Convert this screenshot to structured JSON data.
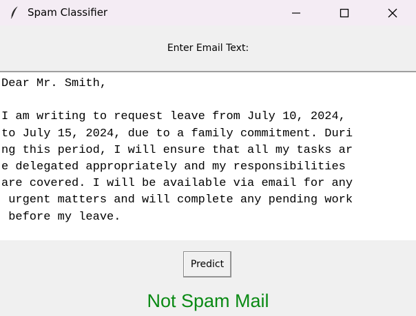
{
  "window": {
    "title": "Spam Classifier",
    "icon": "feather-icon",
    "controls": [
      "minimize-icon",
      "maximize-icon",
      "close-icon"
    ]
  },
  "prompt": {
    "label": "Enter Email Text:"
  },
  "email": {
    "lines": [
      "Dear Mr. Smith,",
      "",
      "I am writing to request leave from July 10, 2024,",
      "to July 15, 2024, due to a family commitment. Duri",
      "ng this period, I will ensure that all my tasks ar",
      "e delegated appropriately and my responsibilities",
      "are covered. I will be available via email for any",
      " urgent matters and will complete any pending work",
      " before my leave."
    ]
  },
  "actions": {
    "predict_label": "Predict"
  },
  "result": {
    "text": "Not Spam Mail",
    "color": "#0a8a14"
  },
  "colors": {
    "titlebar": "#f4ecf4",
    "window_bg": "#f0f0f0",
    "text_bg": "#ffffff"
  }
}
